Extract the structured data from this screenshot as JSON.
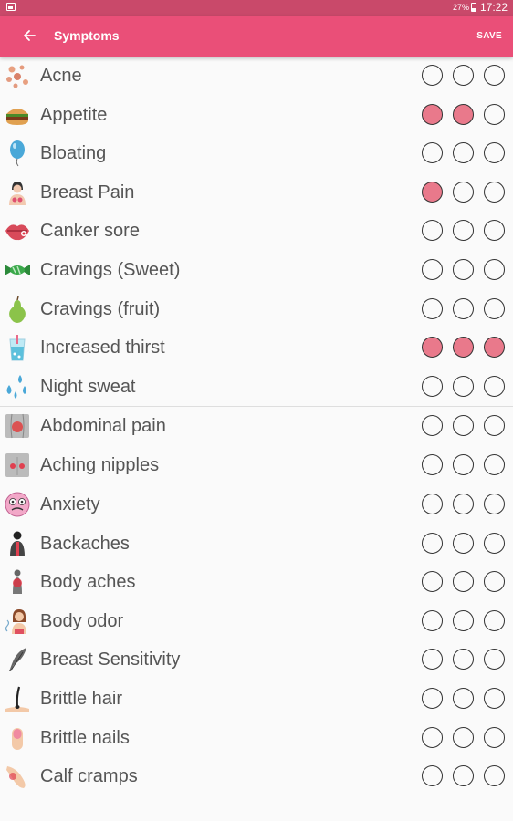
{
  "status_bar": {
    "battery": "27%",
    "time": "17:22"
  },
  "app_bar": {
    "title": "Symptoms",
    "save_label": "SAVE"
  },
  "colors": {
    "primary": "#ea4f78",
    "status_bar": "#c9496a",
    "selected": "#e9798b"
  },
  "symptoms": [
    {
      "label": "Acne",
      "icon": "acne-icon",
      "level": 0
    },
    {
      "label": "Appetite",
      "icon": "burger-icon",
      "level": 2
    },
    {
      "label": "Bloating",
      "icon": "balloon-icon",
      "level": 0
    },
    {
      "label": "Breast Pain",
      "icon": "breast-pain-icon",
      "level": 1
    },
    {
      "label": "Canker sore",
      "icon": "lips-icon",
      "level": 0
    },
    {
      "label": "Cravings (Sweet)",
      "icon": "candy-icon",
      "level": 0
    },
    {
      "label": "Cravings (fruit)",
      "icon": "pear-icon",
      "level": 0
    },
    {
      "label": "Increased thirst",
      "icon": "drink-icon",
      "level": 3
    },
    {
      "label": "Night sweat",
      "icon": "sweat-drops-icon",
      "level": 0
    },
    {
      "label": "Abdominal pain",
      "icon": "abdomen-icon",
      "level": 0
    },
    {
      "label": "Aching nipples",
      "icon": "nipples-icon",
      "level": 0
    },
    {
      "label": "Anxiety",
      "icon": "anxious-face-icon",
      "level": 0
    },
    {
      "label": "Backaches",
      "icon": "back-icon",
      "level": 0
    },
    {
      "label": "Body aches",
      "icon": "body-icon",
      "level": 0
    },
    {
      "label": "Body odor",
      "icon": "odor-icon",
      "level": 0
    },
    {
      "label": "Breast Sensitivity",
      "icon": "feather-icon",
      "level": 0
    },
    {
      "label": "Brittle hair",
      "icon": "hair-icon",
      "level": 0
    },
    {
      "label": "Brittle nails",
      "icon": "nail-icon",
      "level": 0
    },
    {
      "label": "Calf cramps",
      "icon": "calf-icon",
      "level": 0
    }
  ]
}
